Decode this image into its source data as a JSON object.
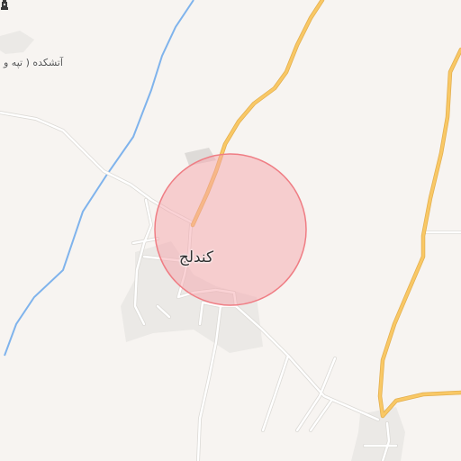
{
  "map": {
    "place_label": "کندلج",
    "poi": {
      "label": "آتشکده ( تپه و",
      "icon": "landmark-tower-icon"
    },
    "colors": {
      "land": "#f7f4f1",
      "road_minor": "#ffffff",
      "road_minor_casing": "#dcdad6",
      "road_major": "#f9c865",
      "road_major_casing": "#e2ae4e",
      "river": "#7fb3ec",
      "builtup": "#ebe9e6",
      "highlight_fill": "#f5a6ab",
      "highlight_stroke": "#ef7d84"
    },
    "highlight_radius_note": ""
  }
}
